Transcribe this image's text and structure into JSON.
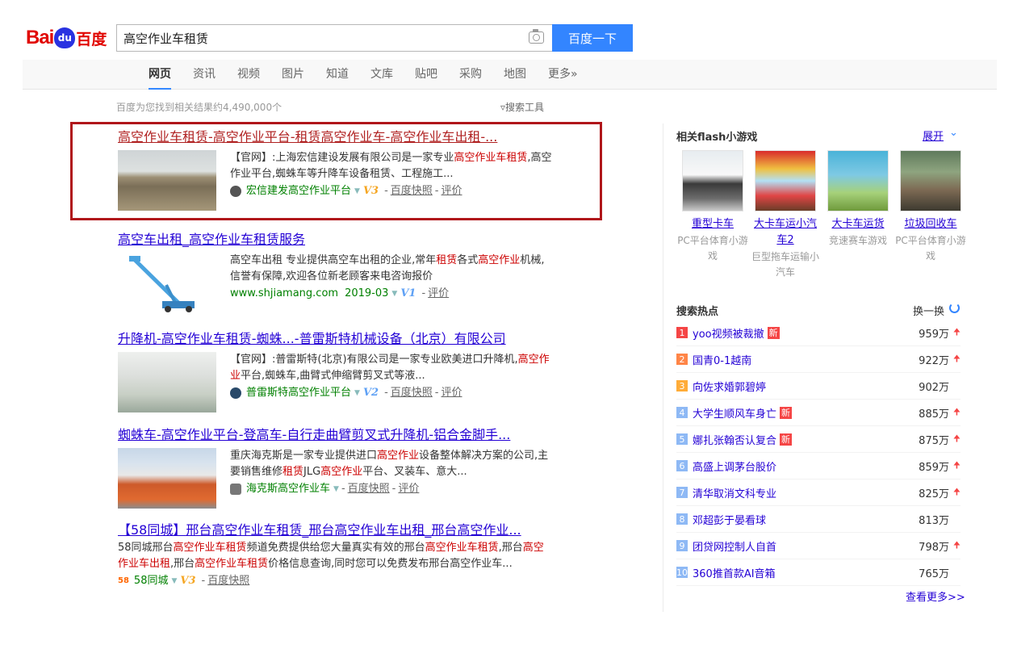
{
  "logo": {
    "bai": "Bai",
    "du": "du",
    "cn": "百度"
  },
  "search": {
    "query": "高空作业车租赁",
    "button": "百度一下"
  },
  "nav": [
    {
      "label": "网页",
      "active": true
    },
    {
      "label": "资讯"
    },
    {
      "label": "视频"
    },
    {
      "label": "图片"
    },
    {
      "label": "知道"
    },
    {
      "label": "文库"
    },
    {
      "label": "贴吧"
    },
    {
      "label": "采购"
    },
    {
      "label": "地图"
    },
    {
      "label": "更多»"
    }
  ],
  "results_count": "百度为您找到相关结果约4,490,000个",
  "search_tools": "搜索工具",
  "results": [
    {
      "title": "高空作业车租赁-高空作业平台-租赁高空作业车-高空作业车出租-...",
      "abstract_parts": [
        "【官网】:上海宏信建设发展有限公司是一家专业",
        "高空作业车租赁",
        ",高空作业平台,蜘蛛车等升降车设备租赁、工程施工..."
      ],
      "site": "宏信建发高空作业平台",
      "badge": "V3",
      "snapshot": "百度快照",
      "review": "评价"
    },
    {
      "title": "高空车出租_高空作业车租赁服务",
      "abstract_parts": [
        "高空车出租 专业提供高空车出租的企业,常年",
        "租赁",
        "各式",
        "高空作业",
        "机械,信誉有保障,欢迎各位新老顾客来电咨询报价"
      ],
      "site": "www.shjiamang.com",
      "date": "2019-03",
      "badge": "V1",
      "review": "评价"
    },
    {
      "title": "升降机-高空作业车租赁-蜘蛛...-普雷斯特机械设备（北京）有限公司",
      "abstract_parts": [
        "【官网】:普雷斯特(北京)有限公司是一家专业欧美进口升降机,",
        "高空作业",
        "平台,蜘蛛车,曲臂式伸缩臂剪叉式等液..."
      ],
      "site": "普雷斯特高空作业平台",
      "badge": "V2",
      "snapshot": "百度快照",
      "review": "评价"
    },
    {
      "title": "蜘蛛车-高空作业平台-登高车-自行走曲臂剪叉式升降机-铝合金脚手...",
      "abstract_parts": [
        "重庆海克斯是一家专业提供进口",
        "高空作业",
        "设备整体解决方案的公司,主要销售维修",
        "租赁",
        "JLG",
        "高空作业",
        "平台、叉装车、意大..."
      ],
      "site": "海克斯高空作业车",
      "snapshot": "百度快照",
      "review": "评价"
    },
    {
      "title": "【58同城】邢台高空作业车租赁_邢台高空作业车出租_邢台高空作业...",
      "abstract_parts": [
        "58同城邢台",
        "高空作业车租赁",
        "频道免费提供给您大量真实有效的邢台",
        "高空作业车租赁",
        ",邢台",
        "高空作业车出租",
        ",邢台",
        "高空作业车租赁",
        "价格信息查询,同时您可以免费发布邢台高空作业车..."
      ],
      "site_icon": "58",
      "site": "58同城",
      "badge": "V3",
      "snapshot": "百度快照"
    }
  ],
  "right": {
    "games_title": "相关flash小游戏",
    "expand": "展开",
    "games": [
      {
        "name": "重型卡车",
        "desc": "PC平台体育小游戏"
      },
      {
        "name": "大卡车运小汽车2",
        "desc": "巨型拖车运输小汽车"
      },
      {
        "name": "大卡车运货",
        "desc": "竞速赛车游戏"
      },
      {
        "name": "垃圾回收车",
        "desc": "PC平台体育小游戏"
      }
    ],
    "hot_title": "搜索热点",
    "refresh": "换一换",
    "hot": [
      {
        "rank": "1",
        "title": "yoo视频被裁撤",
        "new": true,
        "count": "959万",
        "up": true,
        "color": "#f54545"
      },
      {
        "rank": "2",
        "title": "国青0-1越南",
        "new": false,
        "count": "922万",
        "up": true,
        "color": "#ff8547"
      },
      {
        "rank": "3",
        "title": "向佐求婚郭碧婷",
        "new": false,
        "count": "902万",
        "up": false,
        "color": "#ffac38"
      },
      {
        "rank": "4",
        "title": "大学生顺风车身亡",
        "new": true,
        "count": "885万",
        "up": true,
        "color": "#8eb9f5"
      },
      {
        "rank": "5",
        "title": "娜扎张翰否认复合",
        "new": true,
        "count": "875万",
        "up": true,
        "color": "#8eb9f5"
      },
      {
        "rank": "6",
        "title": "高盛上调茅台股价",
        "new": false,
        "count": "859万",
        "up": true,
        "color": "#8eb9f5"
      },
      {
        "rank": "7",
        "title": "清华取消文科专业",
        "new": false,
        "count": "825万",
        "up": true,
        "color": "#8eb9f5"
      },
      {
        "rank": "8",
        "title": "邓超彭于晏看球",
        "new": false,
        "count": "813万",
        "up": false,
        "color": "#8eb9f5"
      },
      {
        "rank": "9",
        "title": "团贷网控制人自首",
        "new": false,
        "count": "798万",
        "up": true,
        "color": "#8eb9f5"
      },
      {
        "rank": "10",
        "title": "360推首款AI音箱",
        "new": false,
        "count": "765万",
        "up": false,
        "color": "#8eb9f5"
      }
    ],
    "new_label": "新",
    "more": "查看更多>>"
  }
}
